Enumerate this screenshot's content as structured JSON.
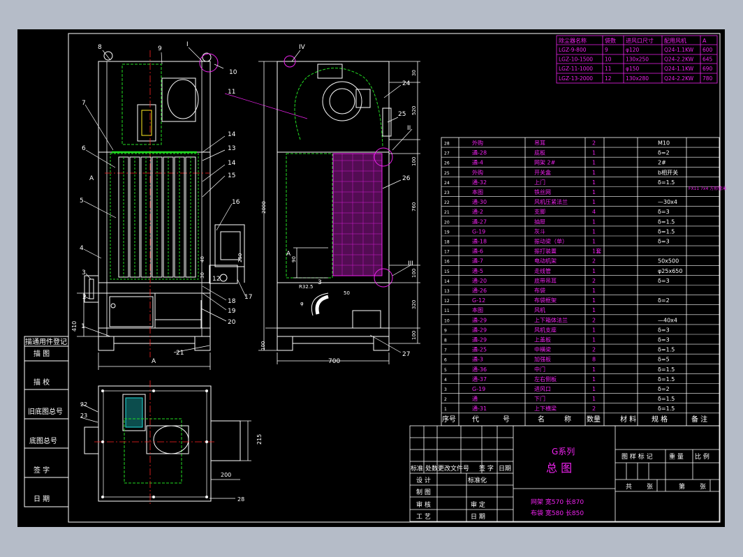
{
  "colors": {
    "bg": "#b5bcc8",
    "sheet": "#000000",
    "white": "#ffffff",
    "green": "#22dd22",
    "magenta": "#ee22ee",
    "red": "#ff2222",
    "cyan": "#22dddd",
    "yellow": "#ffee22"
  },
  "front_labels": [
    "8",
    "9",
    "I",
    "10",
    "7",
    "11",
    "6",
    "14",
    "A",
    "13",
    "14",
    "15",
    "5",
    "16",
    "4",
    "3",
    "18",
    "2",
    "19",
    "1",
    "20",
    "21",
    "12",
    "17"
  ],
  "side_labels": [
    "IV",
    "24",
    "25",
    "II",
    "26",
    "III",
    "27",
    "3",
    "A"
  ],
  "dims": {
    "width_a": "A",
    "height_410": "410",
    "height_100": "100",
    "width_700": "700",
    "height_2000": "2000",
    "d_90": "90",
    "d_50": "50",
    "r32": "R32.5",
    "phi": "φ",
    "d_250": "250",
    "d_40": "40",
    "d_30": "30",
    "v30": "30",
    "v520": "520",
    "v100": "100",
    "v760": "760",
    "v100b": "100",
    "v320": "320",
    "v100c": "100",
    "plan_22": "22",
    "plan_23": "23",
    "plan_215": "215",
    "plan_200": "200",
    "plan_28": "28"
  },
  "spec_table": {
    "headers": [
      "除尘器名称",
      "袋数",
      "进风口尺寸",
      "配用风机",
      "A"
    ],
    "rows": [
      [
        "LGZ-9-800",
        "9",
        "φ120",
        "Q24-1.1KW",
        "600"
      ],
      [
        "LGZ-10-1500",
        "10",
        "130x250",
        "Q24-2.2KW",
        "645"
      ],
      [
        "LGZ-11-1000",
        "11",
        "φ150",
        "Q24-1.1KW",
        "690"
      ],
      [
        "LGZ-13-2000",
        "12",
        "130x280",
        "Q24-2.2KW",
        "780"
      ]
    ]
  },
  "bom": {
    "headers": [
      "序号",
      "代",
      "号",
      "名",
      "称",
      "数量",
      "材 料",
      "规 格",
      "备 注"
    ],
    "side_note": "FX11 7x4\n方形管米",
    "rows": [
      [
        "28",
        "外购",
        "吊耳",
        "2",
        "",
        "M10",
        ""
      ],
      [
        "27",
        "通-28",
        "底板",
        "1",
        "",
        "δ=2",
        ""
      ],
      [
        "26",
        "通-4",
        "网架 2#",
        "1",
        "",
        "2#",
        ""
      ],
      [
        "25",
        "外购",
        "开关盒",
        "1",
        "",
        "b相开关",
        ""
      ],
      [
        "24",
        "通-32",
        "上门",
        "1",
        "",
        "δ=1.5",
        ""
      ],
      [
        "23",
        "本图",
        "铁丝网",
        "1",
        "",
        "",
        ""
      ],
      [
        "22",
        "通-30",
        "风机压紧法兰",
        "1",
        "",
        "—30x4",
        ""
      ],
      [
        "21",
        "通-2",
        "支脚",
        "4",
        "",
        "δ=3",
        ""
      ],
      [
        "20",
        "通-27",
        "抽屉",
        "1",
        "",
        "δ=1.5",
        ""
      ],
      [
        "19",
        "G-19",
        "灰斗",
        "1",
        "",
        "δ=1.5",
        ""
      ],
      [
        "18",
        "通-18",
        "振动梁（单）",
        "1",
        "",
        "δ=3",
        ""
      ],
      [
        "17",
        "通-6",
        "振打装置",
        "1套",
        "",
        "",
        ""
      ],
      [
        "16",
        "通-7",
        "电动机架",
        "2",
        "",
        "50x500",
        ""
      ],
      [
        "15",
        "通-5",
        "走线管",
        "1",
        "",
        "φ25x650",
        ""
      ],
      [
        "14",
        "通-20",
        "底带吊耳",
        "2",
        "",
        "δ=3",
        ""
      ],
      [
        "13",
        "通-26",
        "布袋",
        "1",
        "",
        "",
        ""
      ],
      [
        "12",
        "G-12",
        "布袋框架",
        "1",
        "",
        "δ=2",
        ""
      ],
      [
        "11",
        "本图",
        "风机",
        "1",
        "",
        "",
        ""
      ],
      [
        "10",
        "通-29",
        "上下箱体法兰",
        "2",
        "",
        "—40x4",
        ""
      ],
      [
        "9",
        "通-29",
        "风机支座",
        "1",
        "",
        "δ=3",
        ""
      ],
      [
        "8",
        "通-29",
        "上盖板",
        "1",
        "",
        "δ=3",
        ""
      ],
      [
        "7",
        "通-25",
        "中横梁",
        "2",
        "",
        "δ=1.5",
        ""
      ],
      [
        "6",
        "通-3",
        "加强板",
        "8",
        "",
        "δ=5",
        ""
      ],
      [
        "5",
        "通-36",
        "中门",
        "1",
        "",
        "δ=1.5",
        ""
      ],
      [
        "4",
        "通-37",
        "左右侧板",
        "1",
        "",
        "δ=1.5",
        ""
      ],
      [
        "3",
        "G-19",
        "进风口",
        "1",
        "",
        "δ=2",
        ""
      ],
      [
        "2",
        "通",
        "下门",
        "1",
        "",
        "δ=1.5",
        ""
      ],
      [
        "1",
        "通-31",
        "上下横梁",
        "2",
        "",
        "δ=1.5",
        ""
      ]
    ]
  },
  "left_strip": [
    "描通用件登记",
    "描 图",
    "描 校",
    "旧底图总号",
    "底图总号",
    "签 字",
    "日 期"
  ],
  "title_block": {
    "series": "G系列",
    "drawing_name": "总 图",
    "rev_headers": [
      "标准",
      "处数",
      "更改文件号",
      "签 字",
      "日期"
    ],
    "roles": [
      [
        "设 计",
        "标准化"
      ],
      [
        "制 图",
        ""
      ],
      [
        "审 核",
        "审 定"
      ],
      [
        "工 艺",
        "日 期"
      ]
    ],
    "spec_lines": [
      "网架 宽570 长870",
      "布袋 宽580 长850"
    ],
    "right_headers": [
      "图 样 标 记",
      "重 量",
      "比 例"
    ],
    "sheet": [
      "共",
      "张",
      "第",
      "张"
    ]
  }
}
